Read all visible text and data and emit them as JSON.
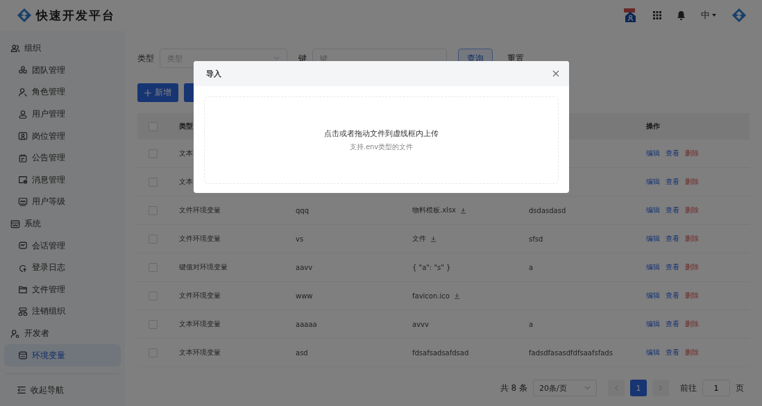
{
  "header": {
    "title": "快速开发平台",
    "language": "中"
  },
  "sidebar": {
    "groups": [
      {
        "label": "组织",
        "items": [
          {
            "label": "团队管理",
            "selected": false
          },
          {
            "label": "角色管理",
            "selected": false
          },
          {
            "label": "用户管理",
            "selected": false
          },
          {
            "label": "岗位管理",
            "selected": false
          },
          {
            "label": "公告管理",
            "selected": false
          },
          {
            "label": "消息管理",
            "selected": false
          },
          {
            "label": "用户等级",
            "selected": false
          }
        ]
      },
      {
        "label": "系统",
        "items": [
          {
            "label": "会话管理",
            "selected": false
          },
          {
            "label": "登录日志",
            "selected": false
          },
          {
            "label": "文件管理",
            "selected": false
          },
          {
            "label": "注销组织",
            "selected": false
          }
        ]
      },
      {
        "label": "开发者",
        "items": [
          {
            "label": "环境变量",
            "selected": true
          }
        ]
      }
    ],
    "collapse": "收起导航"
  },
  "filters": [
    {
      "label": "类型",
      "kind": "select",
      "placeholder": "类型"
    },
    {
      "label": "键",
      "kind": "input",
      "placeholder": "键"
    }
  ],
  "filter_buttons": [
    {
      "label": "查询",
      "kind": "outline"
    },
    {
      "label": "重置",
      "kind": "text"
    }
  ],
  "actions": [
    {
      "label": "新增",
      "kind": "primary"
    },
    {
      "kind": "primary"
    }
  ],
  "table": {
    "columns": [
      {
        "label": "类型"
      },
      {},
      {},
      {},
      {
        "label": "操作"
      }
    ],
    "all_checked": false,
    "rows": [
      {
        "checked": false,
        "type": "文本",
        "actions": [
          "编辑",
          "查看",
          "删除"
        ]
      },
      {
        "checked": false,
        "type": "文本",
        "actions": [
          "编辑",
          "查看",
          "删除"
        ]
      },
      {
        "checked": false,
        "type": "文件环境变量",
        "key": "qqq",
        "value": "物料模板.xlsx",
        "download": true,
        "description": "dsdasdasd",
        "actions": [
          "编辑",
          "查看",
          "删除"
        ]
      },
      {
        "checked": false,
        "type": "文件环境变量",
        "key": "vs",
        "value": "文件",
        "download": true,
        "description": "sfsd",
        "actions": [
          "编辑",
          "查看",
          "删除"
        ]
      },
      {
        "checked": false,
        "type": "键值对环境变量",
        "key": "aavv",
        "value": "{ \"a\": \"s\" }",
        "download": false,
        "description": "a",
        "actions": [
          "编辑",
          "查看",
          "删除"
        ]
      },
      {
        "checked": false,
        "type": "文件环境变量",
        "key": "www",
        "value": "favicon.ico",
        "download": true,
        "actions": [
          "编辑",
          "查看",
          "删除"
        ]
      },
      {
        "checked": false,
        "type": "文本环境变量",
        "key": "aaaaa",
        "value": "avvv",
        "download": false,
        "description": "a",
        "actions": [
          "编辑",
          "查看",
          "删除"
        ]
      },
      {
        "checked": false,
        "type": "文本环境变量",
        "key": "asd",
        "value": "fdsafsadsafdsad",
        "download": false,
        "description": "fadsdfasasdfdfsaafsfads",
        "actions": [
          "编辑",
          "查看",
          "删除"
        ]
      }
    ]
  },
  "pagination": {
    "total": "共 8 条",
    "page_size": "20条/页",
    "pages": [
      {
        "label": "1",
        "selected": true
      }
    ],
    "goto_label": "前往",
    "goto_value": "1",
    "goto_suffix": "页"
  },
  "dialog": {
    "title": "导入",
    "upload_text": "点击或者拖动文件到虚线框内上传",
    "upload_hint": "支持.env类型的文件"
  }
}
